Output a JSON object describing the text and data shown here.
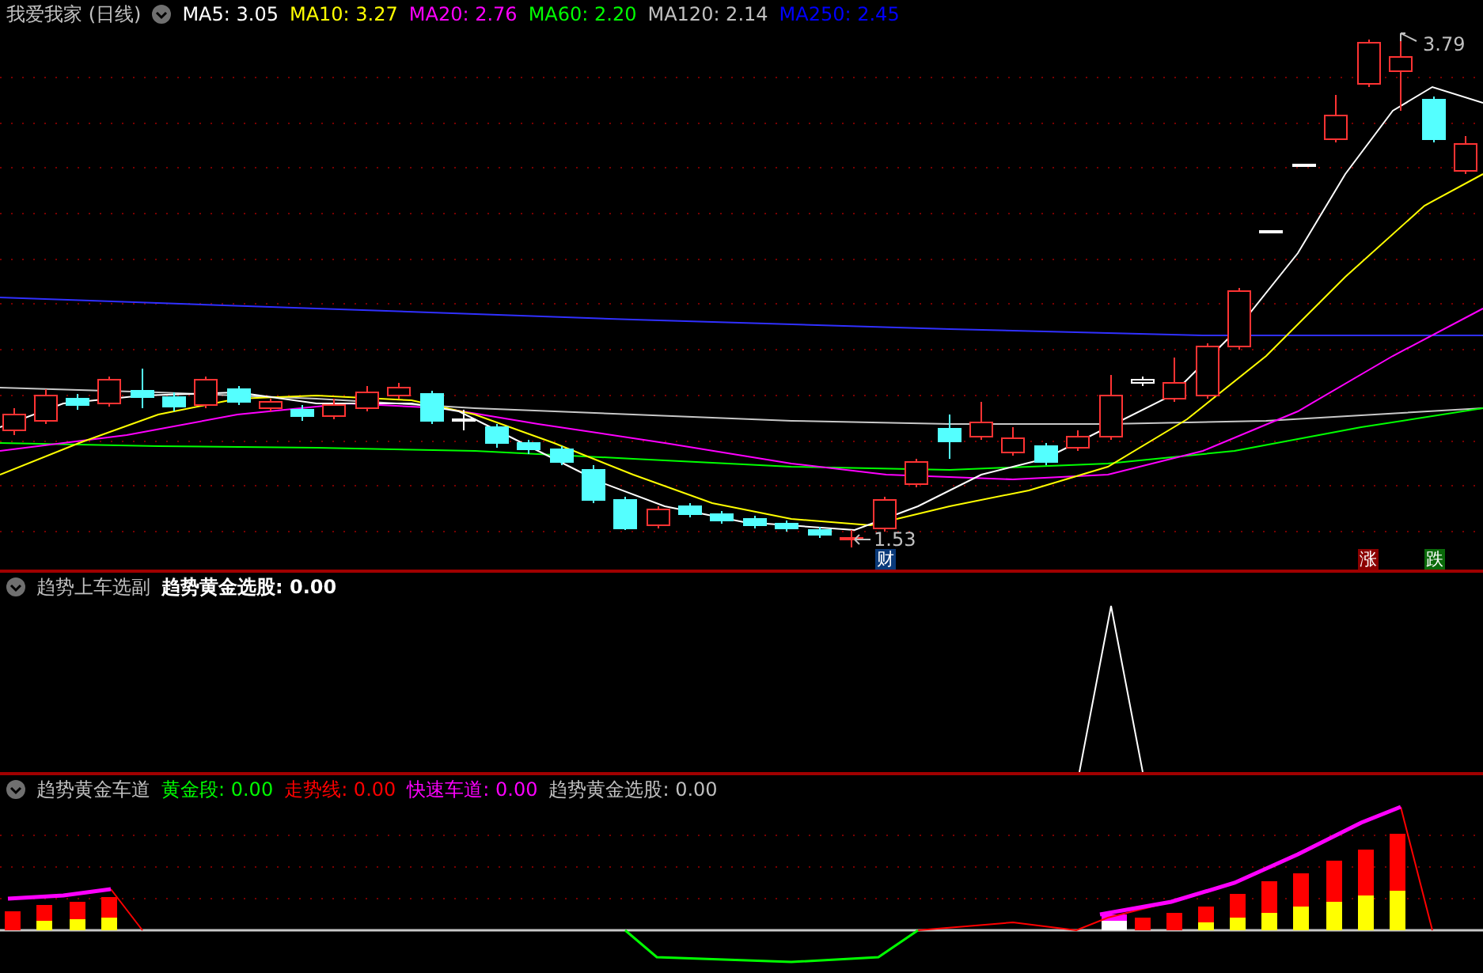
{
  "title": "我爱我家 (日线)",
  "ma_legend": [
    {
      "label": "MA5: 3.05",
      "color": "#ffffff"
    },
    {
      "label": "MA10: 3.27",
      "color": "#ffff00"
    },
    {
      "label": "MA20: 2.76",
      "color": "#ff00ff"
    },
    {
      "label": "MA60: 2.20",
      "color": "#00ff00"
    },
    {
      "label": "MA120: 2.14",
      "color": "#c0c0c0"
    },
    {
      "label": "MA250: 2.45",
      "color": "#0000ff"
    }
  ],
  "price_labels": {
    "high": "3.79",
    "low": "1.53"
  },
  "markers": [
    {
      "text": "财",
      "kind": "finance"
    },
    {
      "text": "涨",
      "kind": "rise"
    },
    {
      "text": "跌",
      "kind": "fall"
    }
  ],
  "panes": [
    {
      "title": "趋势上车选副",
      "values": [
        {
          "label": "趋势黄金选股: 0.00",
          "color": "#ffffff"
        }
      ]
    },
    {
      "title": "趋势黄金车道",
      "values": [
        {
          "label": "黄金段: 0.00",
          "color": "#00ff00"
        },
        {
          "label": "走势线: 0.00",
          "color": "#ff0000"
        },
        {
          "label": "快速车道: 0.00",
          "color": "#ff00ff"
        },
        {
          "label": "趋势黄金选股: 0.00",
          "color": "#c0c0c0"
        }
      ]
    }
  ]
}
